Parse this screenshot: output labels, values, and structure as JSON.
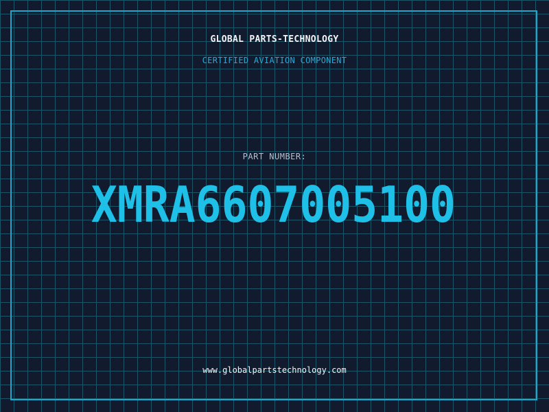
{
  "header": {
    "company": "GLOBAL PARTS-TECHNOLOGY",
    "tagline": "CERTIFIED AVIATION COMPONENT"
  },
  "part": {
    "label": "PART NUMBER:",
    "number": "XMRA6607005100"
  },
  "footer": {
    "website": "www.globalpartstechnology.com"
  },
  "colors": {
    "background": "#121a2e",
    "grid": "#1d5568",
    "frame": "#1ba8cc",
    "accent": "#1ec0e8",
    "tagline": "#27a9d6"
  }
}
